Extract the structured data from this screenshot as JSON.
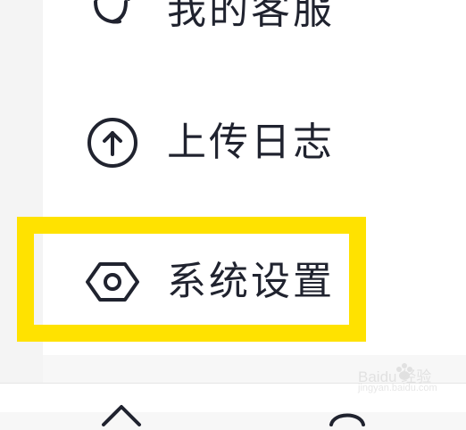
{
  "menu": {
    "items": [
      {
        "label": "我的客服",
        "icon": "headset-icon"
      },
      {
        "label": "上传日志",
        "icon": "upload-icon"
      },
      {
        "label": "系统设置",
        "icon": "settings-icon"
      }
    ]
  },
  "highlight": {
    "color": "#ffe200"
  },
  "watermark": {
    "brand": "Baidu 经验",
    "url": "jingyan.baidu.com"
  }
}
